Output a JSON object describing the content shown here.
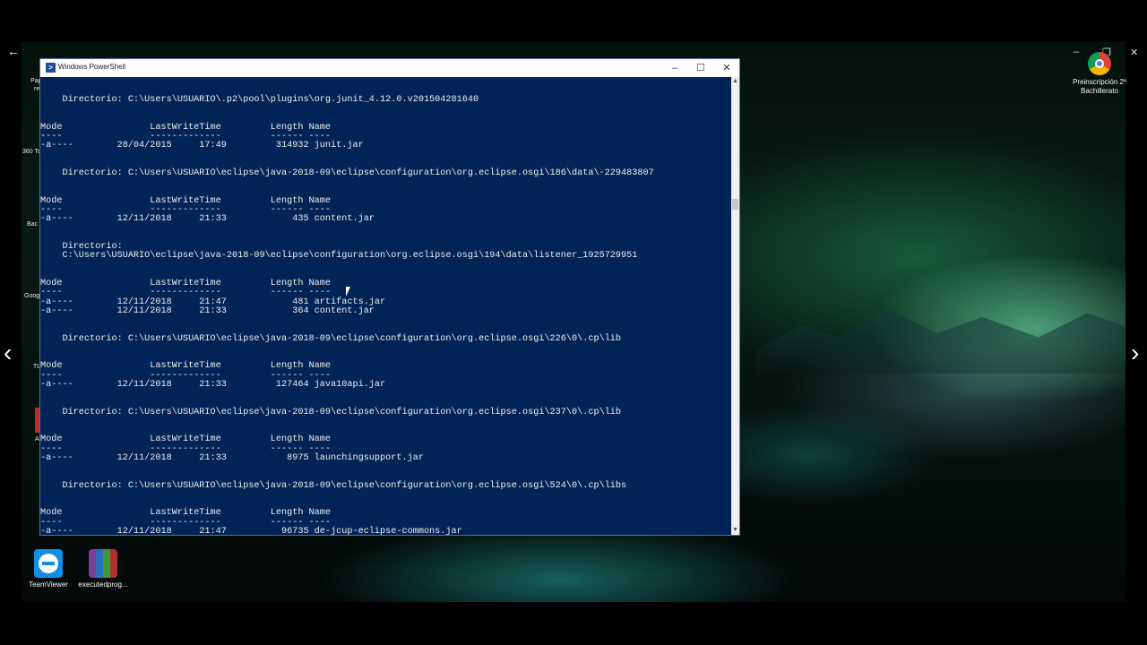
{
  "window": {
    "title": "Windows PowerShell",
    "controls": [
      "–",
      "☐",
      "✕"
    ],
    "console_lines": [
      "    Directorio: C:\\Users\\USUARIO\\.p2\\pool\\plugins\\org.junit_4.12.0.v201504281640",
      "",
      "",
      "Mode                LastWriteTime         Length Name",
      "----                -------------         ------ ----",
      "-a----        28/04/2015     17:49         314932 junit.jar",
      "",
      "",
      "    Directorio: C:\\Users\\USUARIO\\eclipse\\java-2018-09\\eclipse\\configuration\\org.eclipse.osgi\\186\\data\\-229483807",
      "",
      "",
      "Mode                LastWriteTime         Length Name",
      "----                -------------         ------ ----",
      "-a----        12/11/2018     21:33            435 content.jar",
      "",
      "",
      "    Directorio:",
      "    C:\\Users\\USUARIO\\eclipse\\java-2018-09\\eclipse\\configuration\\org.eclipse.osgi\\194\\data\\listener_1925729951",
      "",
      "",
      "Mode                LastWriteTime         Length Name",
      "----                -------------         ------ ----",
      "-a----        12/11/2018     21:47            481 artifacts.jar",
      "-a----        12/11/2018     21:33            364 content.jar",
      "",
      "",
      "    Directorio: C:\\Users\\USUARIO\\eclipse\\java-2018-09\\eclipse\\configuration\\org.eclipse.osgi\\226\\0\\.cp\\lib",
      "",
      "",
      "Mode                LastWriteTime         Length Name",
      "----                -------------         ------ ----",
      "-a----        12/11/2018     21:33         127464 java10api.jar",
      "",
      "",
      "    Directorio: C:\\Users\\USUARIO\\eclipse\\java-2018-09\\eclipse\\configuration\\org.eclipse.osgi\\237\\0\\.cp\\lib",
      "",
      "",
      "Mode                LastWriteTime         Length Name",
      "----                -------------         ------ ----",
      "-a----        12/11/2018     21:33           8975 launchingsupport.jar",
      "",
      "",
      "    Directorio: C:\\Users\\USUARIO\\eclipse\\java-2018-09\\eclipse\\configuration\\org.eclipse.osgi\\524\\0\\.cp\\libs",
      "",
      "",
      "Mode                LastWriteTime         Length Name",
      "----                -------------         ------ ----",
      "-a----        12/11/2018     21:47          96735 de-jcup-eclipse-commons.jar"
    ]
  },
  "desktop_icons": {
    "teamviewer": "TeamViewer",
    "executed": "executedprog...",
    "chrome": "Preinscripción 2º Bachillerato"
  },
  "edge_labels": {
    "pap": "Pap",
    "re": "re",
    "l360": "360 To",
    "bac": "Bac",
    "goo": "Goog",
    "tl": "TL",
    "a": "A"
  },
  "nav": {
    "back": "←",
    "prev": "‹",
    "next": "›"
  },
  "colors": {
    "console_bg": "#012456",
    "console_text": "#eeeeee"
  }
}
